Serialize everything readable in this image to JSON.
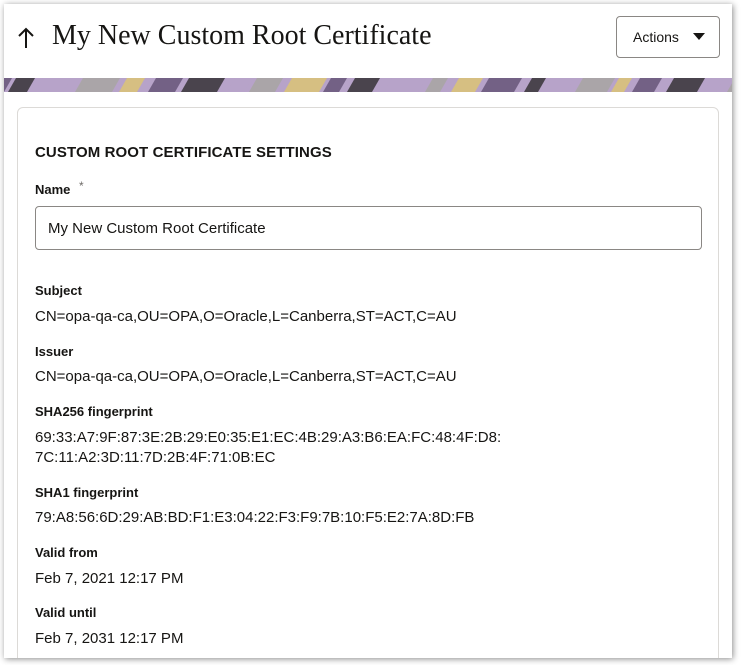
{
  "header": {
    "title": "My New Custom Root Certificate",
    "actions_label": "Actions"
  },
  "colors": {
    "banner": [
      "#6b5a7d",
      "#b7a3c9",
      "#d9c27a",
      "#3e3a3f",
      "#a8a5a4"
    ]
  },
  "settings": {
    "section_title": "CUSTOM ROOT CERTIFICATE SETTINGS",
    "name_label": "Name",
    "name_required_mark": "*",
    "name_value": "My New Custom Root Certificate",
    "subject_label": "Subject",
    "subject_value": "CN=opa-qa-ca,OU=OPA,O=Oracle,L=Canberra,ST=ACT,C=AU",
    "issuer_label": "Issuer",
    "issuer_value": "CN=opa-qa-ca,OU=OPA,O=Oracle,L=Canberra,ST=ACT,C=AU",
    "sha256_label": "SHA256 fingerprint",
    "sha256_line1": "69:33:A7:9F:87:3E:2B:29:E0:35:E1:EC:4B:29:A3:B6:EA:FC:48:4F:D8:",
    "sha256_line2": "7C:11:A2:3D:11:7D:2B:4F:71:0B:EC",
    "sha1_label": "SHA1 fingerprint",
    "sha1_value": "79:A8:56:6D:29:AB:BD:F1:E3:04:22:F3:F9:7B:10:F5:E2:7A:8D:FB",
    "valid_from_label": "Valid from",
    "valid_from_value": "Feb 7, 2021 12:17 PM",
    "valid_until_label": "Valid until",
    "valid_until_value": "Feb 7, 2031 12:17 PM"
  }
}
